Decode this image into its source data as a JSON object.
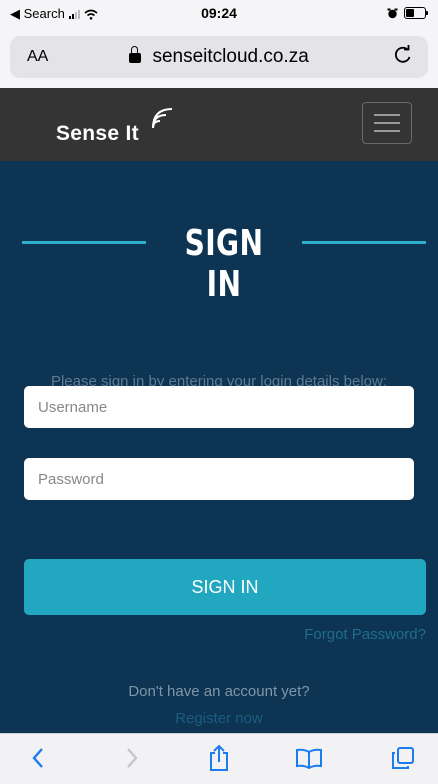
{
  "status_bar": {
    "back_app": "◀ Search",
    "time": "09:24"
  },
  "browser": {
    "aa_label": "AA",
    "url": "senseitcloud.co.za"
  },
  "site": {
    "logo_text": "Sense It",
    "brand_accent": "#2eaecb"
  },
  "login": {
    "title": "SIGN IN",
    "instructions": "Please sign in by entering your login details below:",
    "username_placeholder": "Username",
    "password_placeholder": "Password",
    "submit_label": "SIGN IN",
    "forgot_label": "Forgot Password?",
    "no_account_text": "Don't have an account yet?",
    "register_label": "Register now"
  },
  "toolbar": {
    "icons": [
      "back-icon",
      "forward-icon",
      "share-icon",
      "bookmarks-icon",
      "tabs-icon"
    ]
  },
  "colors": {
    "page_background": "#0d3453",
    "header_background": "#343434",
    "button": "#22a7c0"
  }
}
